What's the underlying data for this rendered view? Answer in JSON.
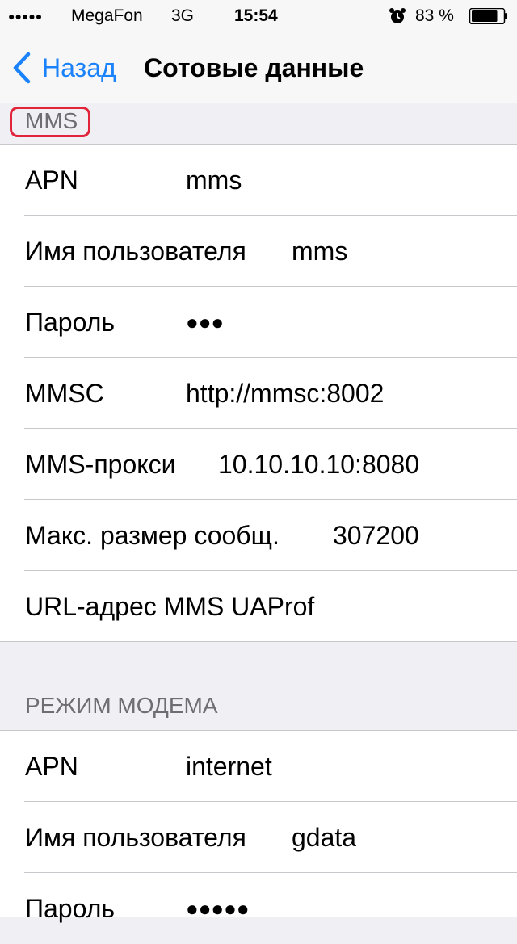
{
  "status_bar": {
    "signal": "●●●●●",
    "carrier": "MegaFon",
    "network": "3G",
    "time": "15:54",
    "battery_text": "83 %",
    "alarm_icon": "alarm-clock-icon",
    "battery_level": 0.83
  },
  "nav": {
    "back_label": "Назад",
    "title": "Сотовые данные"
  },
  "mms_section": {
    "header": "MMS",
    "rows": [
      {
        "label": "APN",
        "value": "mms"
      },
      {
        "label": "Имя пользователя",
        "value": "mms"
      },
      {
        "label": "Пароль",
        "value": "●●●"
      },
      {
        "label": "MMSC",
        "value": "http://mmsc:8002"
      },
      {
        "label": "MMS-прокси",
        "value": "10.10.10.10:8080"
      },
      {
        "label": "Макс. размер сообщ.",
        "value": "307200"
      },
      {
        "label": "URL-адрес MMS UAProf",
        "value": ""
      }
    ]
  },
  "modem_section": {
    "header": "РЕЖИМ МОДЕМА",
    "rows": [
      {
        "label": "APN",
        "value": "internet"
      },
      {
        "label": "Имя пользователя",
        "value": "gdata"
      },
      {
        "label": "Пароль",
        "value": "●●●●●"
      }
    ]
  },
  "colors": {
    "accent": "#1a82fb",
    "highlight": "#e2243a"
  }
}
